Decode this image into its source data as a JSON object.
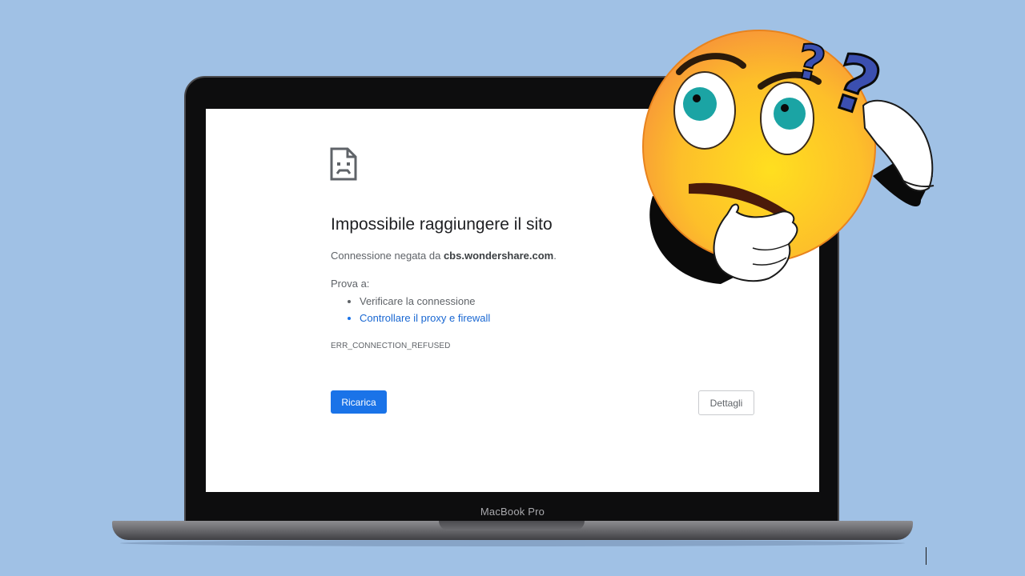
{
  "laptop": {
    "brand_label": "MacBook Pro"
  },
  "error_page": {
    "title": "Impossibile raggiungere il sito",
    "description_prefix": "Connessione negata da ",
    "description_host": "cbs.wondershare.com",
    "description_suffix": ".",
    "try_label": "Prova a:",
    "suggestions": [
      "Verificare la connessione",
      "Controllare il proxy e firewall"
    ],
    "error_code": "ERR_CONNECTION_REFUSED",
    "reload_button": "Ricarica",
    "details_button": "Dettagli",
    "accent_color": "#1a73e8",
    "icon": "sad-page-icon"
  },
  "overlay": {
    "icon": "confused-thinking-emoji-icon",
    "question_marks": [
      "?",
      "?"
    ]
  }
}
